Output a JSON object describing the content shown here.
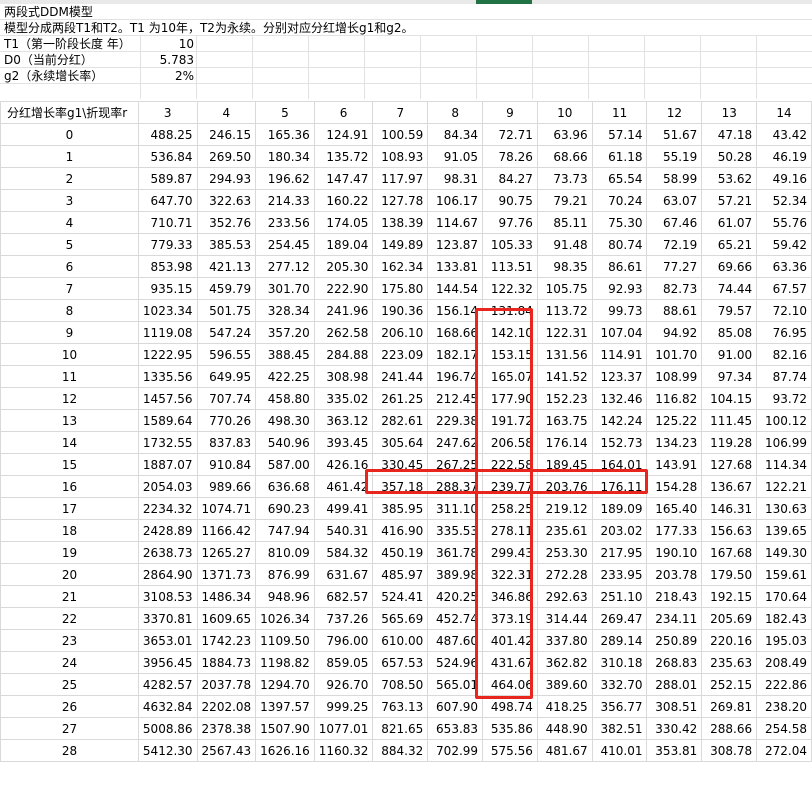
{
  "header": {
    "title": "两段式DDM模型",
    "description": "模型分成两段T1和T2。T1 为10年，T2为永续。分别对应分红增长g1和g2。",
    "params": [
      {
        "label": "T1（第一阶段长度 年）",
        "value": "10"
      },
      {
        "label": "D0（当前分红）",
        "value": "5.783"
      },
      {
        "label": "g2（永续增长率）",
        "value": "2%"
      }
    ]
  },
  "table": {
    "corner": "分红增长率g1\\折现率r",
    "columns": [
      "3",
      "4",
      "5",
      "6",
      "7",
      "8",
      "9",
      "10",
      "11",
      "12",
      "13",
      "14"
    ],
    "rows": [
      {
        "g1": "0",
        "values": [
          "488.25",
          "246.15",
          "165.36",
          "124.91",
          "100.59",
          "84.34",
          "72.71",
          "63.96",
          "57.14",
          "51.67",
          "47.18",
          "43.42"
        ]
      },
      {
        "g1": "1",
        "values": [
          "536.84",
          "269.50",
          "180.34",
          "135.72",
          "108.93",
          "91.05",
          "78.26",
          "68.66",
          "61.18",
          "55.19",
          "50.28",
          "46.19"
        ]
      },
      {
        "g1": "2",
        "values": [
          "589.87",
          "294.93",
          "196.62",
          "147.47",
          "117.97",
          "98.31",
          "84.27",
          "73.73",
          "65.54",
          "58.99",
          "53.62",
          "49.16"
        ]
      },
      {
        "g1": "3",
        "values": [
          "647.70",
          "322.63",
          "214.33",
          "160.22",
          "127.78",
          "106.17",
          "90.75",
          "79.21",
          "70.24",
          "63.07",
          "57.21",
          "52.34"
        ]
      },
      {
        "g1": "4",
        "values": [
          "710.71",
          "352.76",
          "233.56",
          "174.05",
          "138.39",
          "114.67",
          "97.76",
          "85.11",
          "75.30",
          "67.46",
          "61.07",
          "55.76"
        ]
      },
      {
        "g1": "5",
        "values": [
          "779.33",
          "385.53",
          "254.45",
          "189.04",
          "149.89",
          "123.87",
          "105.33",
          "91.48",
          "80.74",
          "72.19",
          "65.21",
          "59.42"
        ]
      },
      {
        "g1": "6",
        "values": [
          "853.98",
          "421.13",
          "277.12",
          "205.30",
          "162.34",
          "133.81",
          "113.51",
          "98.35",
          "86.61",
          "77.27",
          "69.66",
          "63.36"
        ]
      },
      {
        "g1": "7",
        "values": [
          "935.15",
          "459.79",
          "301.70",
          "222.90",
          "175.80",
          "144.54",
          "122.32",
          "105.75",
          "92.93",
          "82.73",
          "74.44",
          "67.57"
        ]
      },
      {
        "g1": "8",
        "values": [
          "1023.34",
          "501.75",
          "328.34",
          "241.96",
          "190.36",
          "156.14",
          "131.84",
          "113.72",
          "99.73",
          "88.61",
          "79.57",
          "72.10"
        ]
      },
      {
        "g1": "9",
        "values": [
          "1119.08",
          "547.24",
          "357.20",
          "262.58",
          "206.10",
          "168.66",
          "142.10",
          "122.31",
          "107.04",
          "94.92",
          "85.08",
          "76.95"
        ]
      },
      {
        "g1": "10",
        "values": [
          "1222.95",
          "596.55",
          "388.45",
          "284.88",
          "223.09",
          "182.17",
          "153.15",
          "131.56",
          "114.91",
          "101.70",
          "91.00",
          "82.16"
        ]
      },
      {
        "g1": "11",
        "values": [
          "1335.56",
          "649.95",
          "422.25",
          "308.98",
          "241.44",
          "196.74",
          "165.07",
          "141.52",
          "123.37",
          "108.99",
          "97.34",
          "87.74"
        ]
      },
      {
        "g1": "12",
        "values": [
          "1457.56",
          "707.74",
          "458.80",
          "335.02",
          "261.25",
          "212.45",
          "177.90",
          "152.23",
          "132.46",
          "116.82",
          "104.15",
          "93.72"
        ]
      },
      {
        "g1": "13",
        "values": [
          "1589.64",
          "770.26",
          "498.30",
          "363.12",
          "282.61",
          "229.38",
          "191.72",
          "163.75",
          "142.24",
          "125.22",
          "111.45",
          "100.12"
        ]
      },
      {
        "g1": "14",
        "values": [
          "1732.55",
          "837.83",
          "540.96",
          "393.45",
          "305.64",
          "247.62",
          "206.58",
          "176.14",
          "152.73",
          "134.23",
          "119.28",
          "106.99"
        ]
      },
      {
        "g1": "15",
        "values": [
          "1887.07",
          "910.84",
          "587.00",
          "426.16",
          "330.45",
          "267.25",
          "222.58",
          "189.45",
          "164.01",
          "143.91",
          "127.68",
          "114.34"
        ]
      },
      {
        "g1": "16",
        "values": [
          "2054.03",
          "989.66",
          "636.68",
          "461.42",
          "357.18",
          "288.37",
          "239.77",
          "203.76",
          "176.11",
          "154.28",
          "136.67",
          "122.21"
        ]
      },
      {
        "g1": "17",
        "values": [
          "2234.32",
          "1074.71",
          "690.23",
          "499.41",
          "385.95",
          "311.10",
          "258.25",
          "219.12",
          "189.09",
          "165.40",
          "146.31",
          "130.63"
        ]
      },
      {
        "g1": "18",
        "values": [
          "2428.89",
          "1166.42",
          "747.94",
          "540.31",
          "416.90",
          "335.53",
          "278.11",
          "235.61",
          "203.02",
          "177.33",
          "156.63",
          "139.65"
        ]
      },
      {
        "g1": "19",
        "values": [
          "2638.73",
          "1265.27",
          "810.09",
          "584.32",
          "450.19",
          "361.78",
          "299.43",
          "253.30",
          "217.95",
          "190.10",
          "167.68",
          "149.30"
        ]
      },
      {
        "g1": "20",
        "values": [
          "2864.90",
          "1371.73",
          "876.99",
          "631.67",
          "485.97",
          "389.98",
          "322.31",
          "272.28",
          "233.95",
          "203.78",
          "179.50",
          "159.61"
        ]
      },
      {
        "g1": "21",
        "values": [
          "3108.53",
          "1486.34",
          "948.96",
          "682.57",
          "524.41",
          "420.25",
          "346.86",
          "292.63",
          "251.10",
          "218.43",
          "192.15",
          "170.64"
        ]
      },
      {
        "g1": "22",
        "values": [
          "3370.81",
          "1609.65",
          "1026.34",
          "737.26",
          "565.69",
          "452.74",
          "373.19",
          "314.44",
          "269.47",
          "234.11",
          "205.69",
          "182.43"
        ]
      },
      {
        "g1": "23",
        "values": [
          "3653.01",
          "1742.23",
          "1109.50",
          "796.00",
          "610.00",
          "487.60",
          "401.42",
          "337.80",
          "289.14",
          "250.89",
          "220.16",
          "195.03"
        ]
      },
      {
        "g1": "24",
        "values": [
          "3956.45",
          "1884.73",
          "1198.82",
          "859.05",
          "657.53",
          "524.96",
          "431.67",
          "362.82",
          "310.18",
          "268.83",
          "235.63",
          "208.49"
        ]
      },
      {
        "g1": "25",
        "values": [
          "4282.57",
          "2037.78",
          "1294.70",
          "926.70",
          "708.50",
          "565.01",
          "464.06",
          "389.60",
          "332.70",
          "288.01",
          "252.15",
          "222.86"
        ]
      },
      {
        "g1": "26",
        "values": [
          "4632.84",
          "2202.08",
          "1397.57",
          "999.25",
          "763.13",
          "607.90",
          "498.74",
          "418.25",
          "356.77",
          "308.51",
          "269.81",
          "238.20"
        ]
      },
      {
        "g1": "27",
        "values": [
          "5008.86",
          "2378.38",
          "1507.90",
          "1077.01",
          "821.65",
          "653.83",
          "535.86",
          "448.90",
          "382.51",
          "330.42",
          "288.66",
          "254.58"
        ]
      },
      {
        "g1": "28",
        "values": [
          "5412.30",
          "2567.43",
          "1626.16",
          "1160.32",
          "884.32",
          "702.99",
          "575.56",
          "481.67",
          "410.01",
          "353.81",
          "308.78",
          "272.04"
        ]
      }
    ]
  },
  "colors": {
    "highlight": "#e8261d",
    "gridline": "#d9d9d9",
    "selected_column": "#217346"
  }
}
